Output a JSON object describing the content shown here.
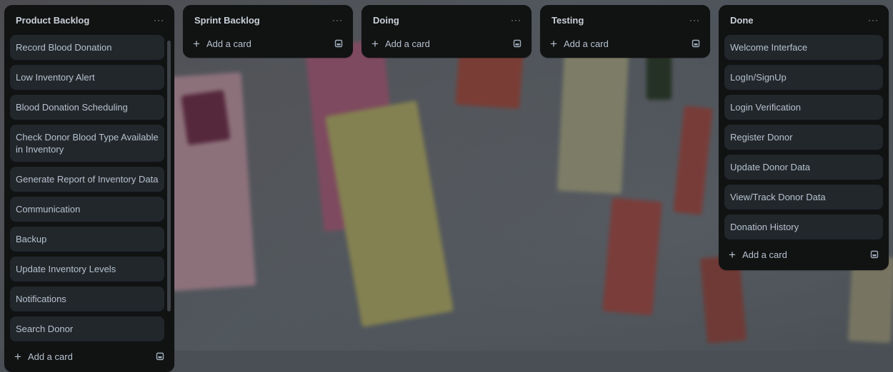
{
  "lists": [
    {
      "title": "Product Backlog",
      "more": "···",
      "cards": [
        "Record Blood Donation",
        "Low Inventory Alert",
        "Blood Donation Scheduling",
        "Check Donor Blood Type Available in Inventory",
        "Generate Report of Inventory Data",
        "Communication",
        "Backup",
        "Update Inventory Levels",
        "Notifications",
        "Search Donor"
      ],
      "add_label": "Add a card"
    },
    {
      "title": "Sprint Backlog",
      "more": "···",
      "cards": [],
      "add_label": "Add a card"
    },
    {
      "title": "Doing",
      "more": "···",
      "cards": [],
      "add_label": "Add a card"
    },
    {
      "title": "Testing",
      "more": "···",
      "cards": [],
      "add_label": "Add a card"
    },
    {
      "title": "Done",
      "more": "···",
      "cards": [
        "Welcome Interface",
        "LogIn/SignUp",
        "Login Verification",
        "Register Donor",
        "Update Donor Data",
        "View/Track Donor Data",
        "Donation History"
      ],
      "add_label": "Add a card"
    }
  ],
  "icons": {
    "more": "more-horizontal-icon",
    "add": "plus-icon",
    "template": "card-template-icon"
  },
  "colors": {
    "list_bg": "#111212",
    "card_bg": "#22272b",
    "text": "#b6c2cf"
  }
}
